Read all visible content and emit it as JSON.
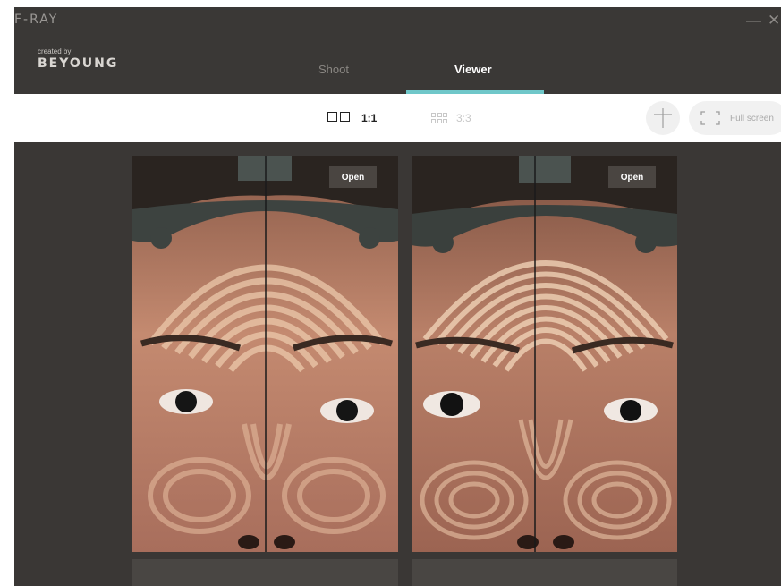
{
  "window": {
    "title": "F-RAY",
    "minimize_symbol": "—",
    "close_symbol": "✕"
  },
  "brand": {
    "created_by": "created by",
    "name": "BEYOUNG"
  },
  "tabs": [
    {
      "label": "Shoot",
      "active": false
    },
    {
      "label": "Viewer",
      "active": true
    }
  ],
  "toolbar": {
    "layout_1x1_label": "1:1",
    "layout_3x3_label": "3:3",
    "crosshair_icon": "crosshair-icon",
    "fullscreen_label": "Full screen"
  },
  "viewer": {
    "panels": [
      {
        "open_label": "Open"
      },
      {
        "open_label": "Open"
      }
    ]
  },
  "colors": {
    "accent": "#6fc7c9",
    "header_bg": "#3a3836",
    "viewer_bg": "#3a3735",
    "stripe_light": "#e8c4a6",
    "stripe_dark": "#6b3e2e"
  }
}
